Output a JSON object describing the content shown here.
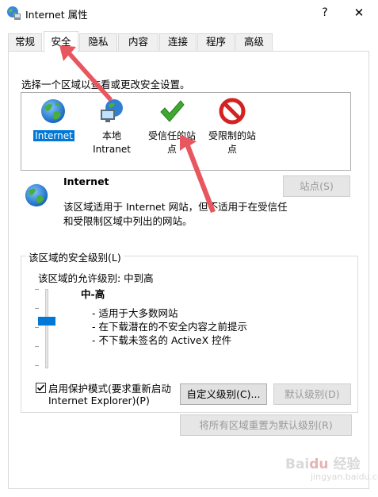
{
  "window": {
    "title": "Internet 属性",
    "help_label": "?",
    "close_label": "✕"
  },
  "tabs": [
    {
      "label": "常规",
      "active": false
    },
    {
      "label": "安全",
      "active": true
    },
    {
      "label": "隐私",
      "active": false
    },
    {
      "label": "内容",
      "active": false
    },
    {
      "label": "连接",
      "active": false
    },
    {
      "label": "程序",
      "active": false
    },
    {
      "label": "高级",
      "active": false
    }
  ],
  "security": {
    "zone_prompt": "选择一个区域以查看或更改安全设置。",
    "zones": [
      {
        "label_line1": "Internet",
        "label_line2": "",
        "icon": "globe-icon",
        "selected": true
      },
      {
        "label_line1": "本地",
        "label_line2": "Intranet",
        "icon": "intranet-icon",
        "selected": false
      },
      {
        "label_line1": "受信任的站",
        "label_line2": "点",
        "icon": "checkmark-icon",
        "selected": false
      },
      {
        "label_line1": "受限制的站",
        "label_line2": "点",
        "icon": "restricted-icon",
        "selected": false
      }
    ],
    "selected_zone": {
      "name": "Internet",
      "desc_line1": "该区域适用于 Internet 网站，但不适用于在受信任",
      "desc_line2": "和受限制区域中列出的网站。",
      "sites_button": "站点(S)"
    },
    "level_group": {
      "label": "该区域的安全级别(L)",
      "allowed": "该区域的允许级别: 中到高",
      "level_name": "中-高",
      "level_fraction": 0.4,
      "descriptions": [
        "- 适用于大多数网站",
        "- 在下载潜在的不安全内容之前提示",
        "- 不下载未签名的 ActiveX 控件"
      ],
      "protected_mode_line1": "启用保护模式(要求重新启动",
      "protected_mode_line2": "Internet Explorer)(P)",
      "protected_mode_checked": true,
      "custom_level_button": "自定义级别(C)...",
      "default_level_button": "默认级别(D)",
      "reset_all_button": "将所有区域重置为默认级别(R)"
    }
  },
  "colors": {
    "accent": "#0078d7",
    "annotation_arrow": "#e8575f"
  }
}
